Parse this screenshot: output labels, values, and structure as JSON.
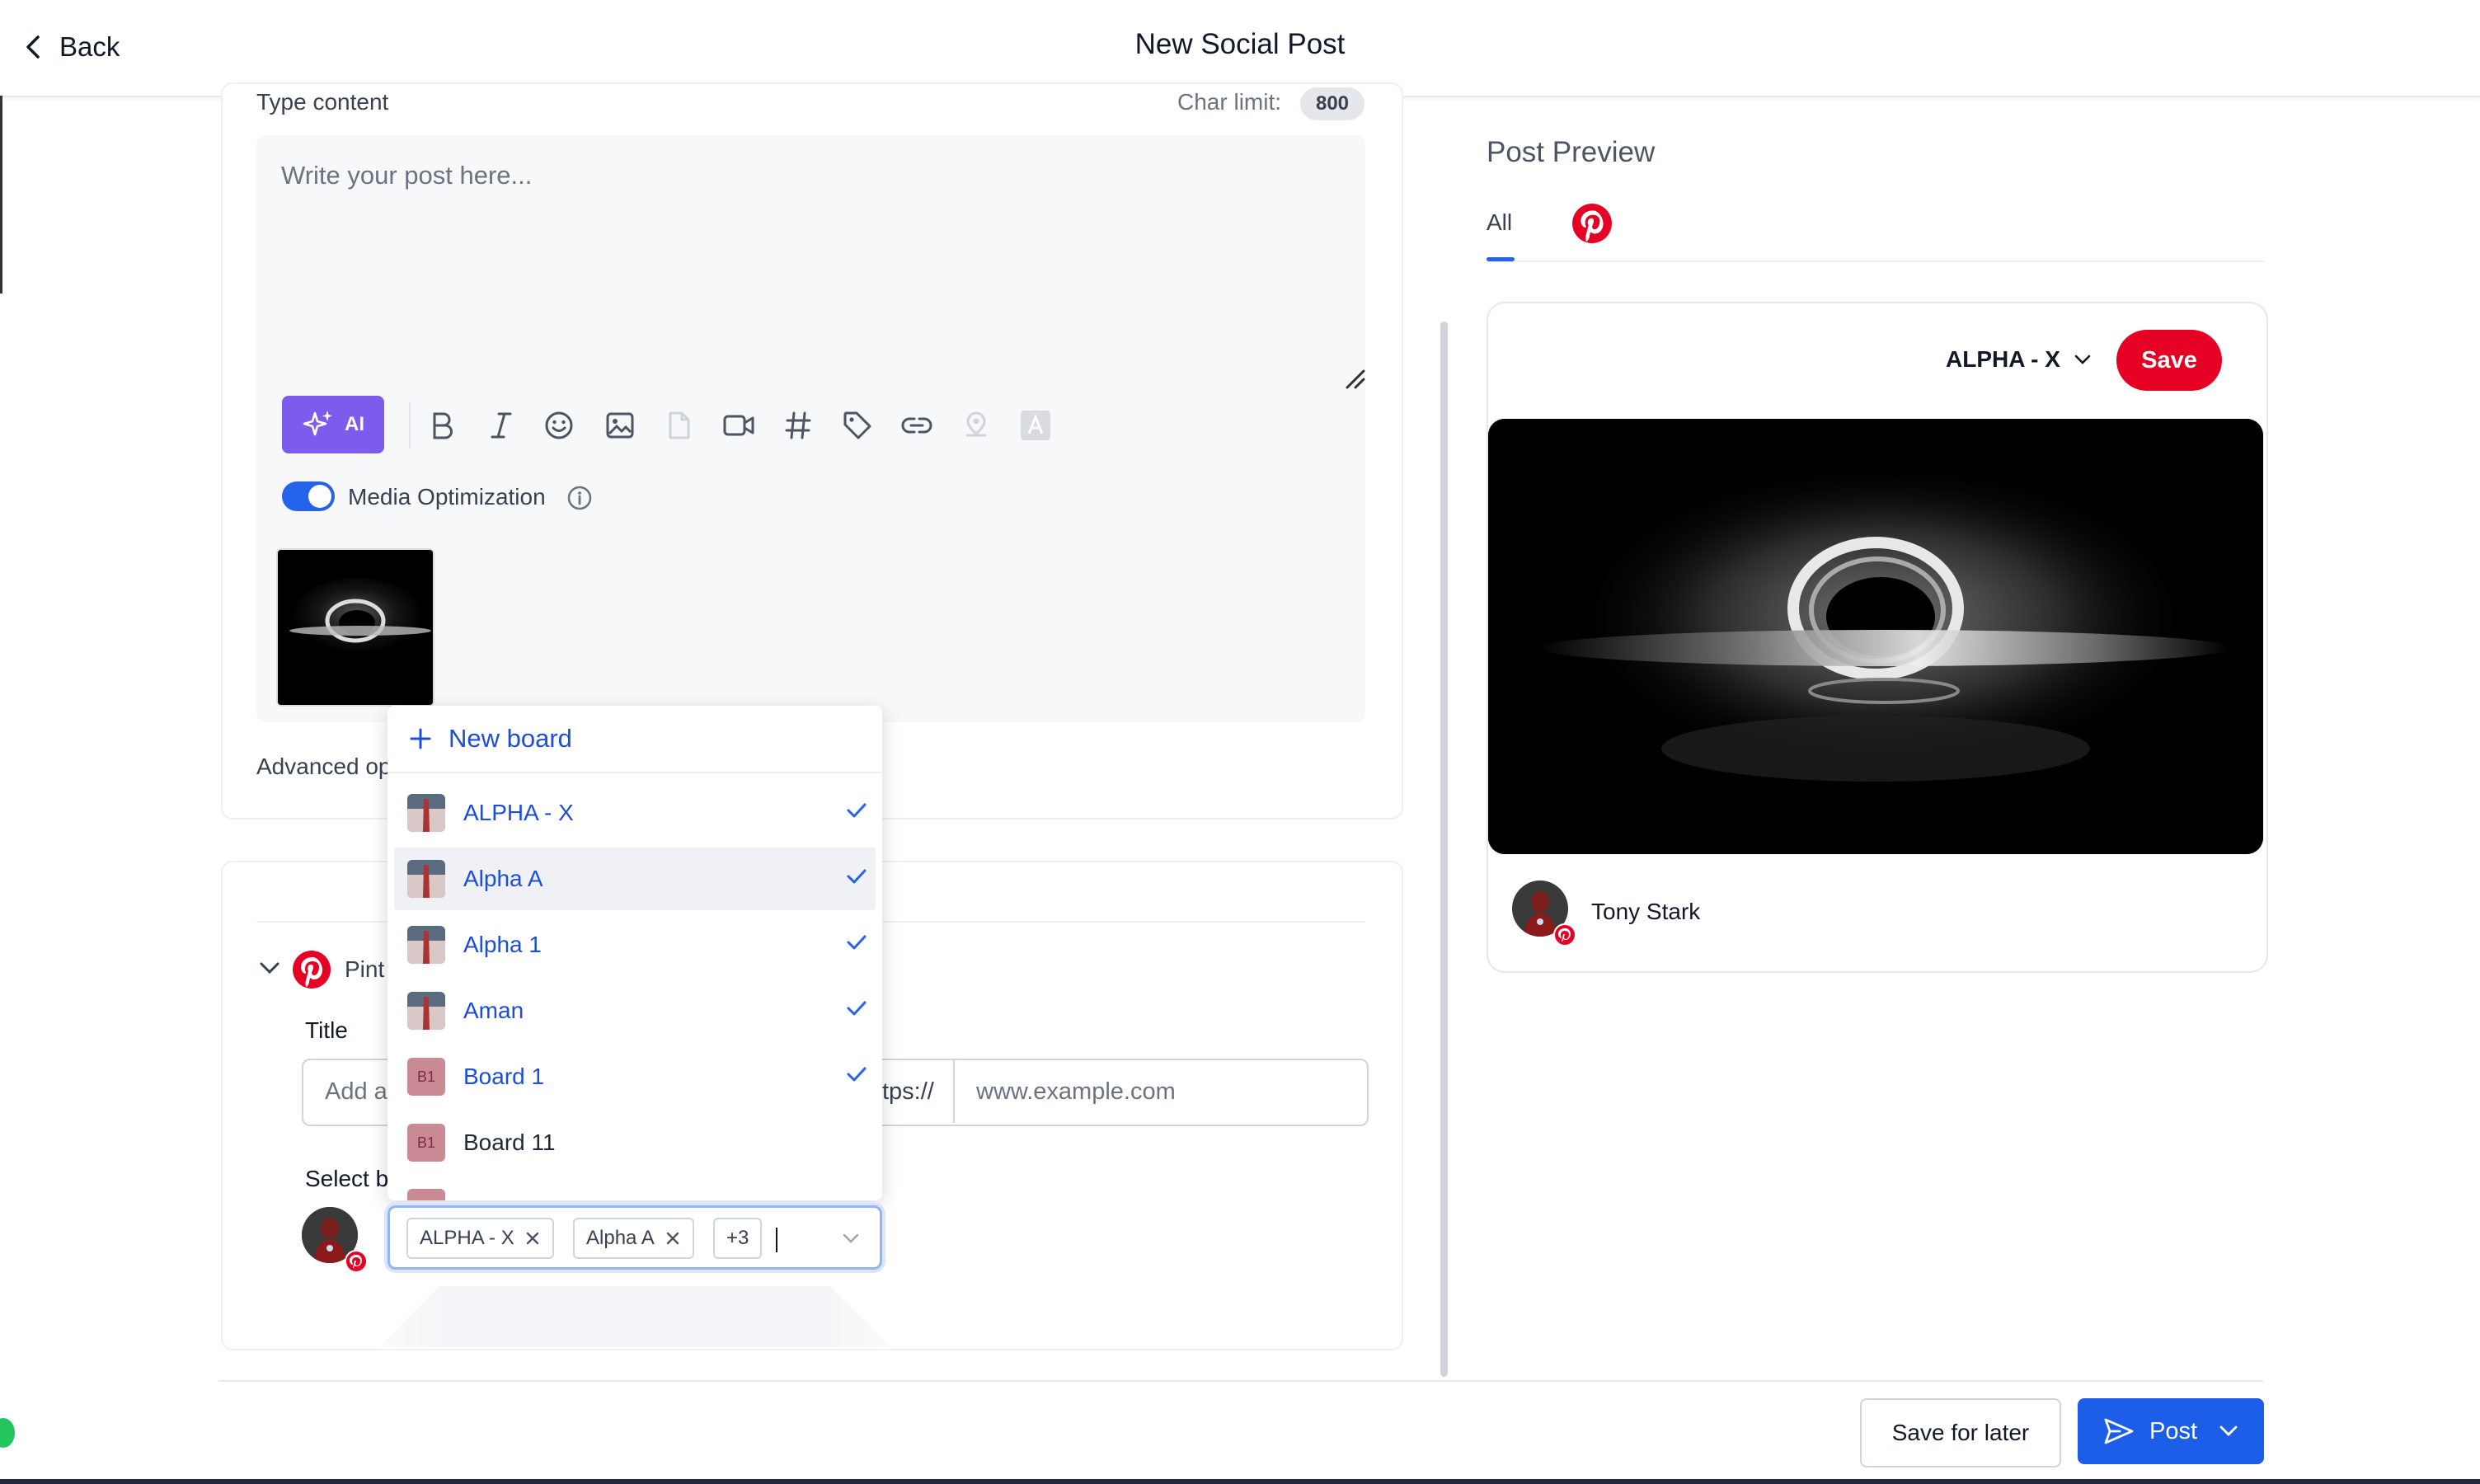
{
  "header": {
    "back_label": "Back",
    "title": "New Social Post"
  },
  "composer": {
    "type_content_label": "Type content",
    "char_limit_label": "Char limit:",
    "char_limit_value": "800",
    "placeholder": "Write your post here...",
    "ai_label": "AI",
    "media_optimization_label": "Media Optimization",
    "advanced_label": "Advanced op"
  },
  "pinterest_section": {
    "network_label": "Pint",
    "title_label": "Title",
    "title_placeholder": "Add a",
    "url_prefix": "tps://",
    "url_placeholder": "www.example.com",
    "select_board_label": "Select b"
  },
  "board_dropdown": {
    "new_board_label": "New board",
    "items": [
      {
        "label": "ALPHA - X",
        "checked": true,
        "avatar": "photo"
      },
      {
        "label": "Alpha A",
        "checked": true,
        "avatar": "photo"
      },
      {
        "label": "Alpha 1",
        "checked": true,
        "avatar": "photo"
      },
      {
        "label": "Aman",
        "checked": true,
        "avatar": "photo"
      },
      {
        "label": "Board 1",
        "checked": true,
        "avatar": "B1"
      },
      {
        "label": "Board 11",
        "checked": false,
        "avatar": "B1"
      }
    ],
    "selected_chips": [
      "ALPHA - X",
      "Alpha A"
    ],
    "more_count": "+3"
  },
  "preview": {
    "title": "Post Preview",
    "tab_all": "All",
    "board_name": "ALPHA - X",
    "save_label": "Save",
    "author": "Tony Stark"
  },
  "footer": {
    "save_later_label": "Save for later",
    "post_label": "Post"
  },
  "colors": {
    "accent": "#1d5ee8",
    "pinterest": "#e60023",
    "ai": "#7c5ced"
  }
}
